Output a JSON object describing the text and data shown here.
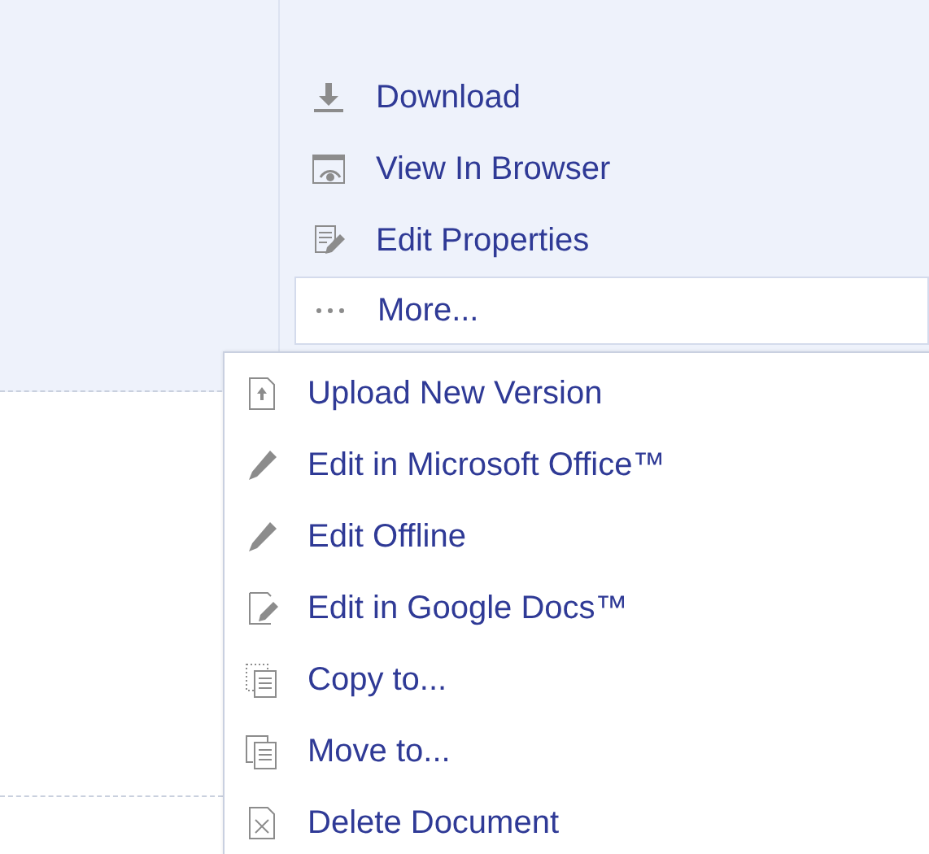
{
  "actions": [
    {
      "label": "Download"
    },
    {
      "label": "View In Browser"
    },
    {
      "label": "Edit Properties"
    }
  ],
  "more": {
    "label": "More...",
    "expanded": true
  },
  "menu": {
    "items": [
      {
        "label": "Upload New Version"
      },
      {
        "label": "Edit in Microsoft Office™"
      },
      {
        "label": "Edit Offline"
      },
      {
        "label": "Edit in Google Docs™"
      },
      {
        "label": "Copy to..."
      },
      {
        "label": "Move to..."
      },
      {
        "label": "Delete Document"
      }
    ]
  }
}
